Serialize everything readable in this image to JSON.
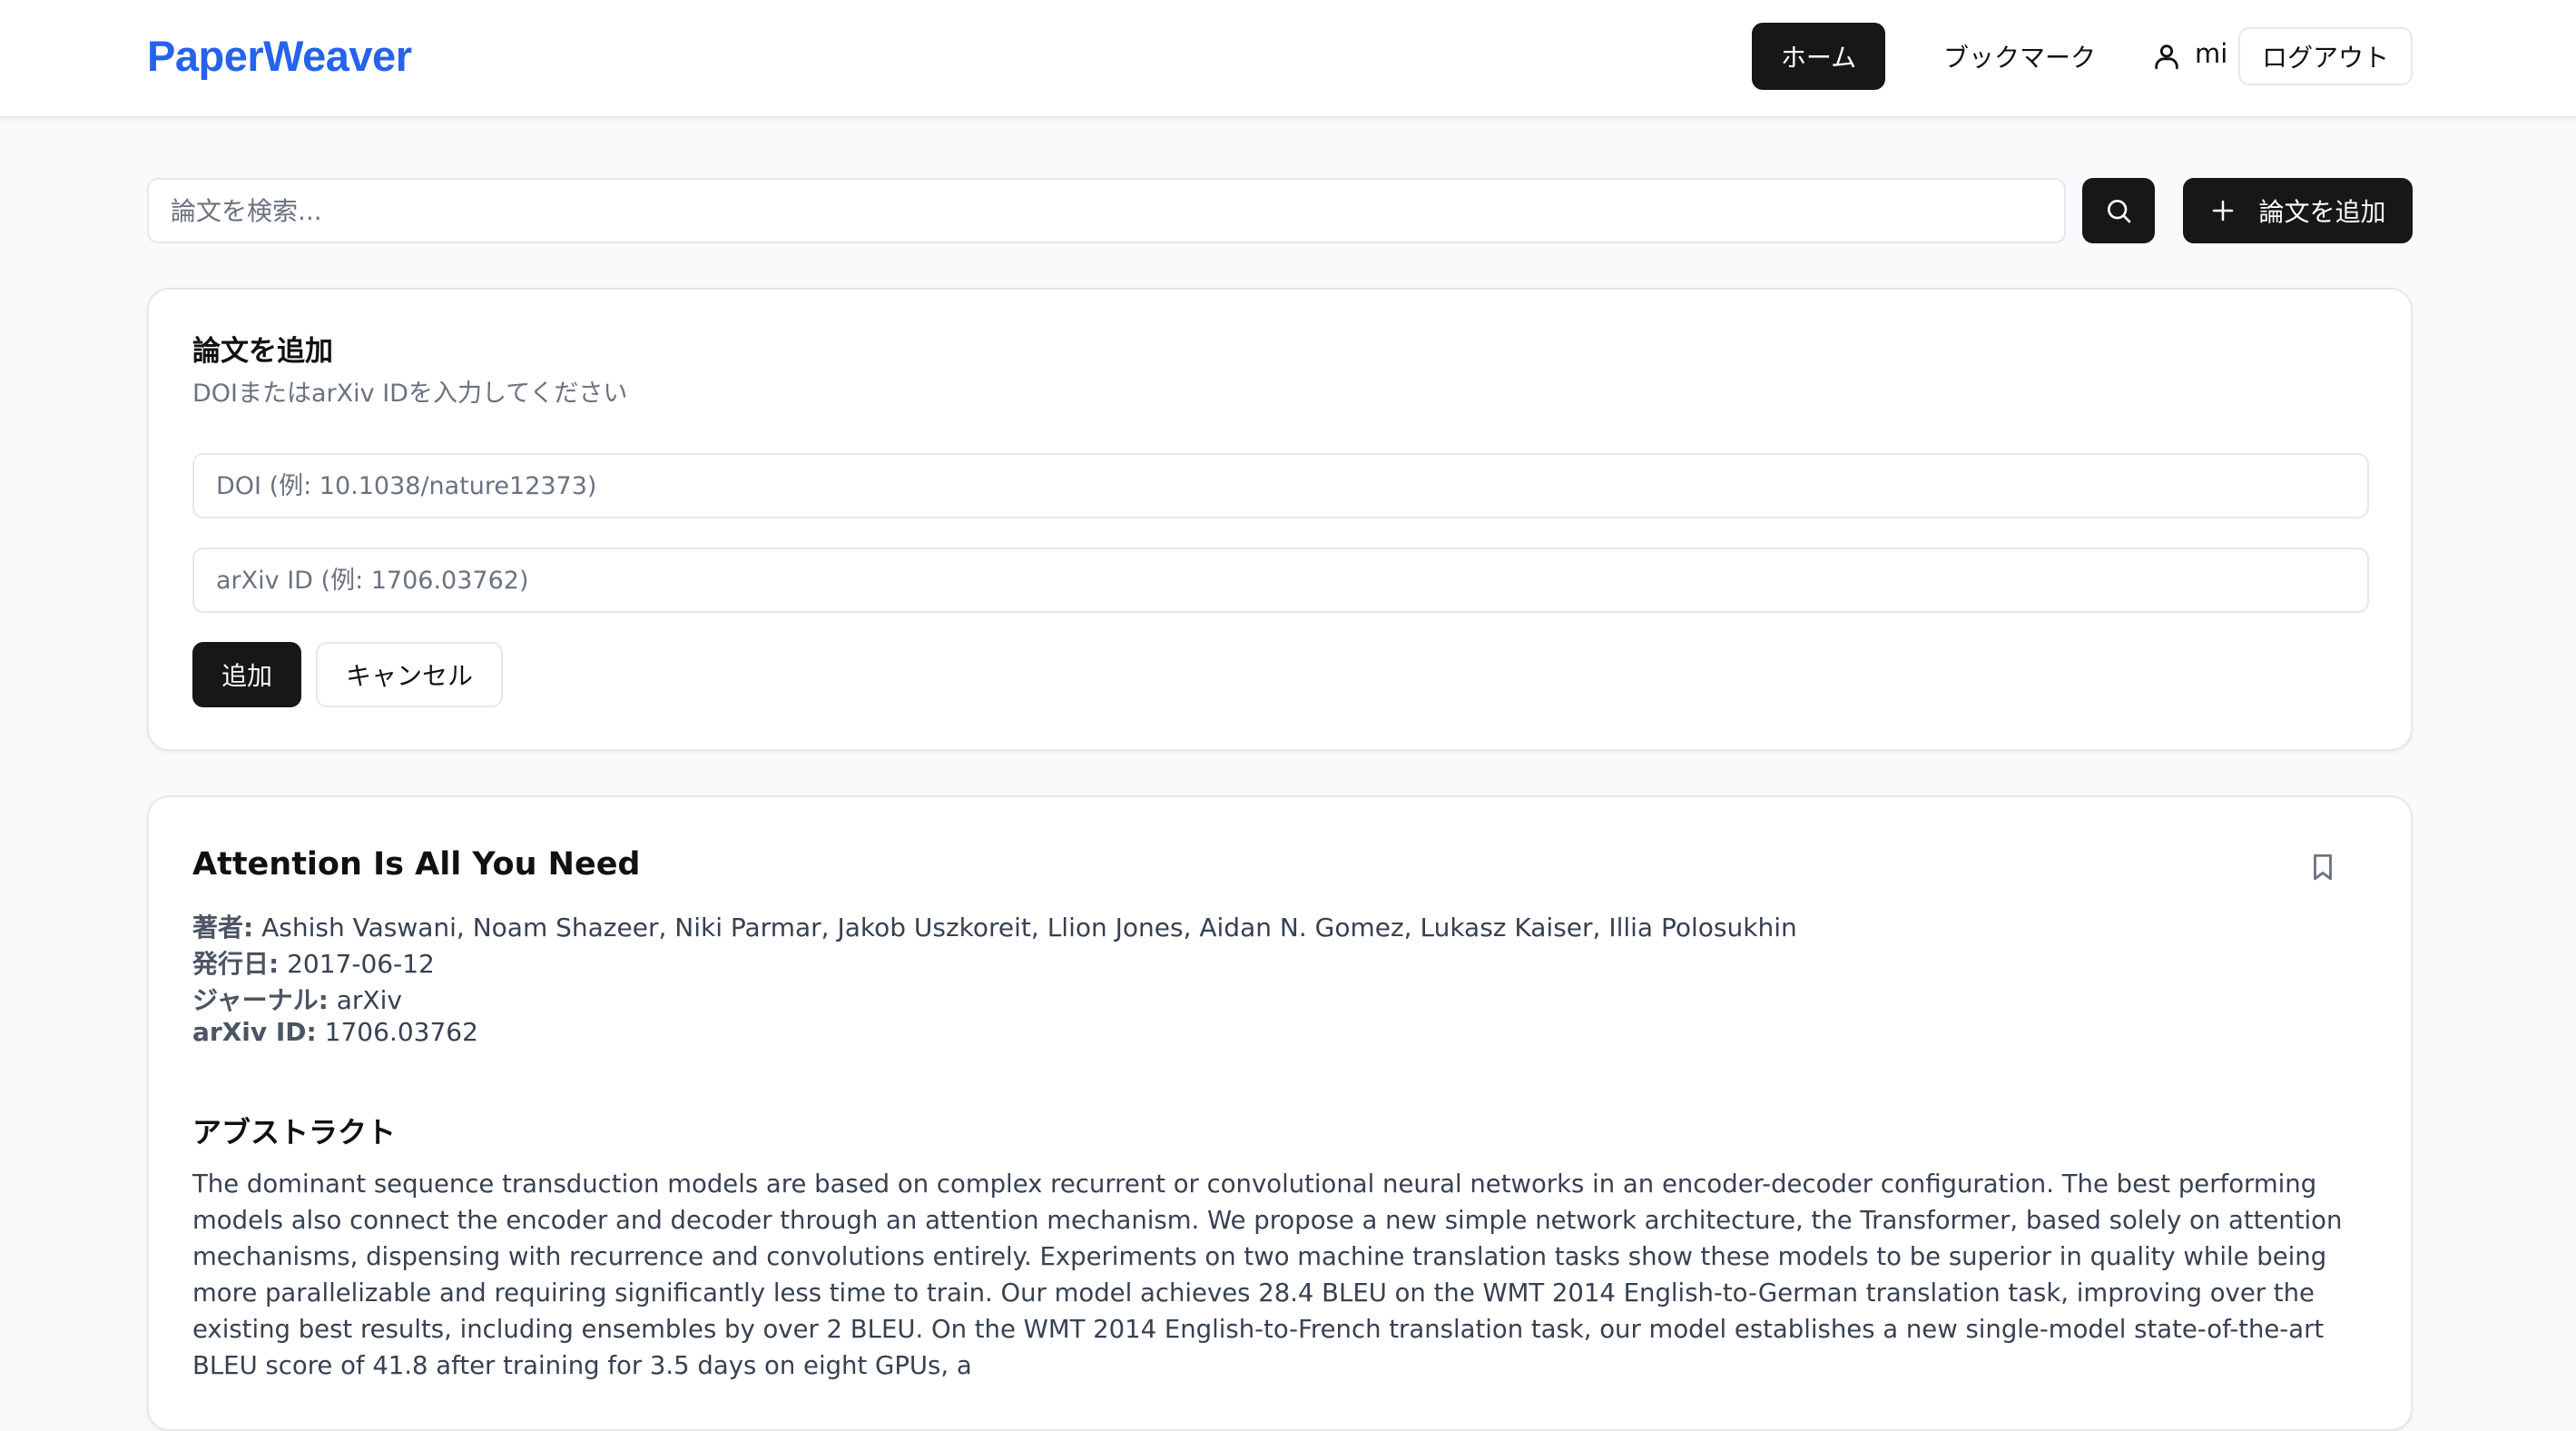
{
  "header": {
    "logo": "PaperWeaver",
    "nav_home": "ホーム",
    "nav_bookmark": "ブックマーク",
    "user_name": "mi",
    "logout": "ログアウト"
  },
  "search": {
    "placeholder": "論文を検索...",
    "add_paper_label": "論文を追加"
  },
  "add_form": {
    "title": "論文を追加",
    "description": "DOIまたはarXiv IDを入力してください",
    "doi_placeholder": "DOI (例: 10.1038/nature12373)",
    "arxiv_placeholder": "arXiv ID (例: 1706.03762)",
    "submit_label": "追加",
    "cancel_label": "キャンセル"
  },
  "paper": {
    "title": "Attention Is All You Need",
    "authors_label": "著者:",
    "authors": "Ashish Vaswani, Noam Shazeer, Niki Parmar, Jakob Uszkoreit, Llion Jones, Aidan N. Gomez, Lukasz Kaiser, Illia Polosukhin",
    "published_label": "発行日:",
    "published": "2017-06-12",
    "journal_label": "ジャーナル:",
    "journal": "arXiv",
    "arxiv_label": "arXiv ID:",
    "arxiv_id": "1706.03762",
    "abstract_heading": "アブストラクト",
    "abstract": "The dominant sequence transduction models are based on complex recurrent or convolutional neural networks in an encoder-decoder configuration. The best performing models also connect the encoder and decoder through an attention mechanism. We propose a new simple network architecture, the Transformer, based solely on attention mechanisms, dispensing with recurrence and convolutions entirely. Experiments on two machine translation tasks show these models to be superior in quality while being more parallelizable and requiring significantly less time to train. Our model achieves 28.4 BLEU on the WMT 2014 English-to-German translation task, improving over the existing best results, including ensembles by over 2 BLEU. On the WMT 2014 English-to-French translation task, our model establishes a new single-model state-of-the-art BLEU score of 41.8 after training for 3.5 days on eight GPUs, a"
  },
  "colors": {
    "brand": "#2563eb",
    "primary_button": "#171717",
    "background": "#f9fafb",
    "border": "#e5e7eb"
  },
  "icons": [
    "user-icon",
    "search-icon",
    "plus-icon",
    "bookmark-icon"
  ]
}
